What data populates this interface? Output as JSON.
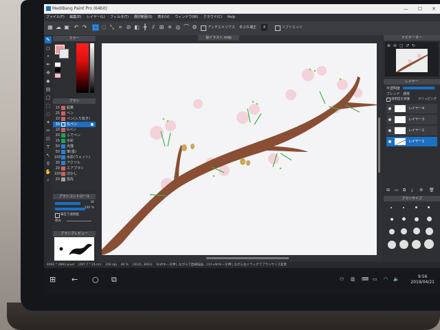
{
  "app": {
    "title": "MediBang Paint Pro (64bit)",
    "document_tab": "桜イラスト.mdp"
  },
  "menu": [
    "ファイル(F)",
    "編集(E)",
    "レイヤー(L)",
    "フィルタ(T)",
    "選択範囲(S)",
    "表示(V)",
    "ウィンドウ(W)",
    "クラウド(C)",
    "Help"
  ],
  "toolbar": {
    "antialias_label": "アンチエイリアス",
    "stabilizer_label": "手ぶれ補正",
    "stabilizer_value": "8",
    "soft_edge_label": "ソフトエッジ"
  },
  "color_panel": {
    "title": "カラー",
    "foreground": "#f09b9b",
    "background": "#e9e9e9",
    "swatches": [
      "#ffffff",
      "#000000",
      "#f2b9c6"
    ]
  },
  "brush_panel": {
    "title": "ブラシ",
    "brushes": [
      {
        "size": "15",
        "color": "#c86464",
        "name": "鉛筆"
      },
      {
        "size": "25",
        "color": "#c86464",
        "name": "ペン"
      },
      {
        "size": "10",
        "color": "#c86464",
        "name": "ペン(入り抜き)"
      },
      {
        "size": "30",
        "color": "#1b75d0",
        "name": "丸ペン"
      },
      {
        "size": "10",
        "color": "#c86464",
        "name": "Gペン"
      },
      {
        "size": "20",
        "color": "#19a55a",
        "name": "ふでペン"
      },
      {
        "size": "15",
        "color": "#19a55a",
        "name": "水彩"
      },
      {
        "size": "50",
        "color": "#2e7fd1",
        "name": "点描"
      },
      {
        "size": "50",
        "color": "#2e7fd1",
        "name": "筆(墨)"
      },
      {
        "size": "100",
        "color": "#2e7fd1",
        "name": "水彩(ウェット)"
      },
      {
        "size": "30",
        "color": "#2e7fd1",
        "name": "アクリル"
      },
      {
        "size": "20",
        "color": "#c86464",
        "name": "エアブラシ"
      },
      {
        "size": "100",
        "color": "#c86464",
        "name": "ぼかし"
      },
      {
        "size": "20",
        "color": "#a0a0a0",
        "name": "指先"
      }
    ],
    "selected_index": 3
  },
  "brush_control": {
    "title": "ブラシコントロール",
    "size_value": "30",
    "opacity_value": "100 %",
    "opacity_fraction": 1.0,
    "size_fraction": 0.85,
    "apply_label": "筆圧で透明度",
    "thickness_label": "厚み"
  },
  "brush_preview": {
    "title": "ブラシプレビュー"
  },
  "navigator": {
    "title": "ナビゲーター"
  },
  "layers_panel": {
    "title": "レイヤー",
    "opacity_label": "不透明度",
    "opacity_value": "100",
    "blend_label": "ブレンド",
    "blend_value": "通常",
    "protect_label": "透明度を保護",
    "clipping_label": "クリッピング",
    "layers": [
      "レイヤー4",
      "レイヤー3",
      "レイヤー2",
      "レイヤー1"
    ],
    "selected_index": 3
  },
  "brush_size_panel": {
    "title": "ブラシサイズ"
  },
  "status": {
    "dims": "4092 * 2893 pixel",
    "physical": "(297.7 * 21cm)",
    "dpi": "350 dpi",
    "zoom": "46 %",
    "coords": "(3035, 3063)",
    "hint": "Shiftキーを押しながらで直線描画、Ctrl+Altキーを押しながら左ドラッグでブラシサイズ変更"
  },
  "taskbar": {
    "time": "9:56",
    "date": "2019/04/21"
  }
}
